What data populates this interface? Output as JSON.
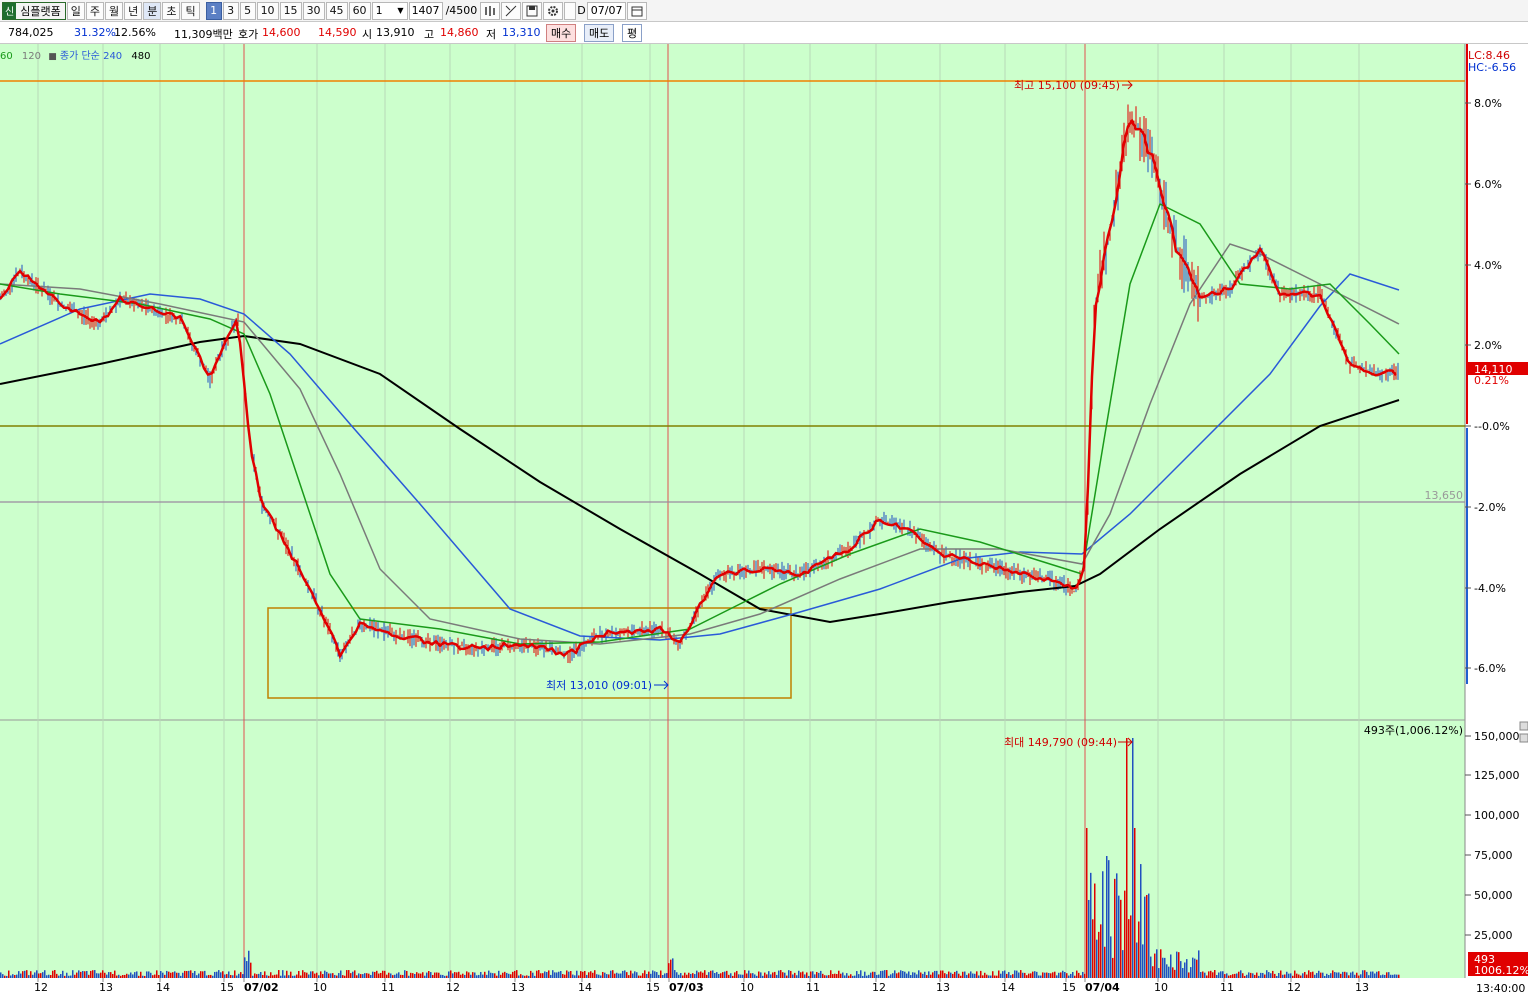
{
  "toolbar": {
    "logo_icon": "신",
    "stock_name": "심플랫폼",
    "period_buttons": [
      "일",
      "주",
      "월",
      "년",
      "분",
      "초",
      "틱"
    ],
    "interval_buttons": [
      "1",
      "3",
      "5",
      "10",
      "15",
      "30",
      "45",
      "60"
    ],
    "interval_input": "1",
    "count_value": "1407",
    "count_total": "/4500",
    "tool_icons": [
      "bars-icon",
      "crosshair-icon",
      "save-icon",
      "gear-icon"
    ],
    "checkbox_label": "D",
    "date_value": "07/07",
    "calendar_icon": "calendar-icon"
  },
  "info": {
    "volume": "784,025",
    "change_rate1": "31.32%",
    "change_rate2": "12.56%",
    "amount": "11,309백만",
    "quote_label": "호가",
    "ask": "14,600",
    "bid": "14,590",
    "open_label": "시",
    "open": "13,910",
    "high_label": "고",
    "high": "14,860",
    "low_label": "저",
    "low": "13,310",
    "buy_label": "매수",
    "sell_label": "매도",
    "avg_label": "평"
  },
  "indicators": {
    "ma60": "60",
    "ma120": "120",
    "desc": "종가 단순",
    "ma240": "240",
    "ma480": "480"
  },
  "price_axis": {
    "lc": "LC:8.46",
    "hc": "HC:-6.56",
    "ticks": [
      "8.0%",
      "6.0%",
      "4.0%",
      "2.0%",
      "0.0%",
      "-2.0%",
      "-4.0%",
      "-6.0%"
    ],
    "current_price": "14,110",
    "current_rate": "0.21%",
    "ref_price_label": "13,650"
  },
  "volume_axis": {
    "ticks": [
      "150,000",
      "125,000",
      "100,000",
      "75,000",
      "50,000",
      "25,000"
    ],
    "current_volume": "493",
    "current_rate": "1006.12%",
    "top_label": "493주(1,006.12%)"
  },
  "annotations": {
    "high": "최고 15,100 (09:45)",
    "low": "최저 13,010 (09:01)",
    "max_volume": "최대 149,790 (09:44)"
  },
  "time_axis": {
    "labels": [
      "12",
      "13",
      "14",
      "15",
      "07/02",
      "10",
      "11",
      "12",
      "13",
      "14",
      "15",
      "07/03",
      "10",
      "11",
      "12",
      "13",
      "14",
      "15",
      "07/04",
      "10",
      "11",
      "12",
      "13"
    ],
    "clock": "13:40:00"
  },
  "colors": {
    "background": "#ccffcc",
    "red_line": "#e00000",
    "green_line": "#1a9a1a",
    "gray_line": "#7a7a7a",
    "blue_line": "#2a5ad8",
    "black_line": "#000000",
    "orange_line": "#f08000"
  }
}
